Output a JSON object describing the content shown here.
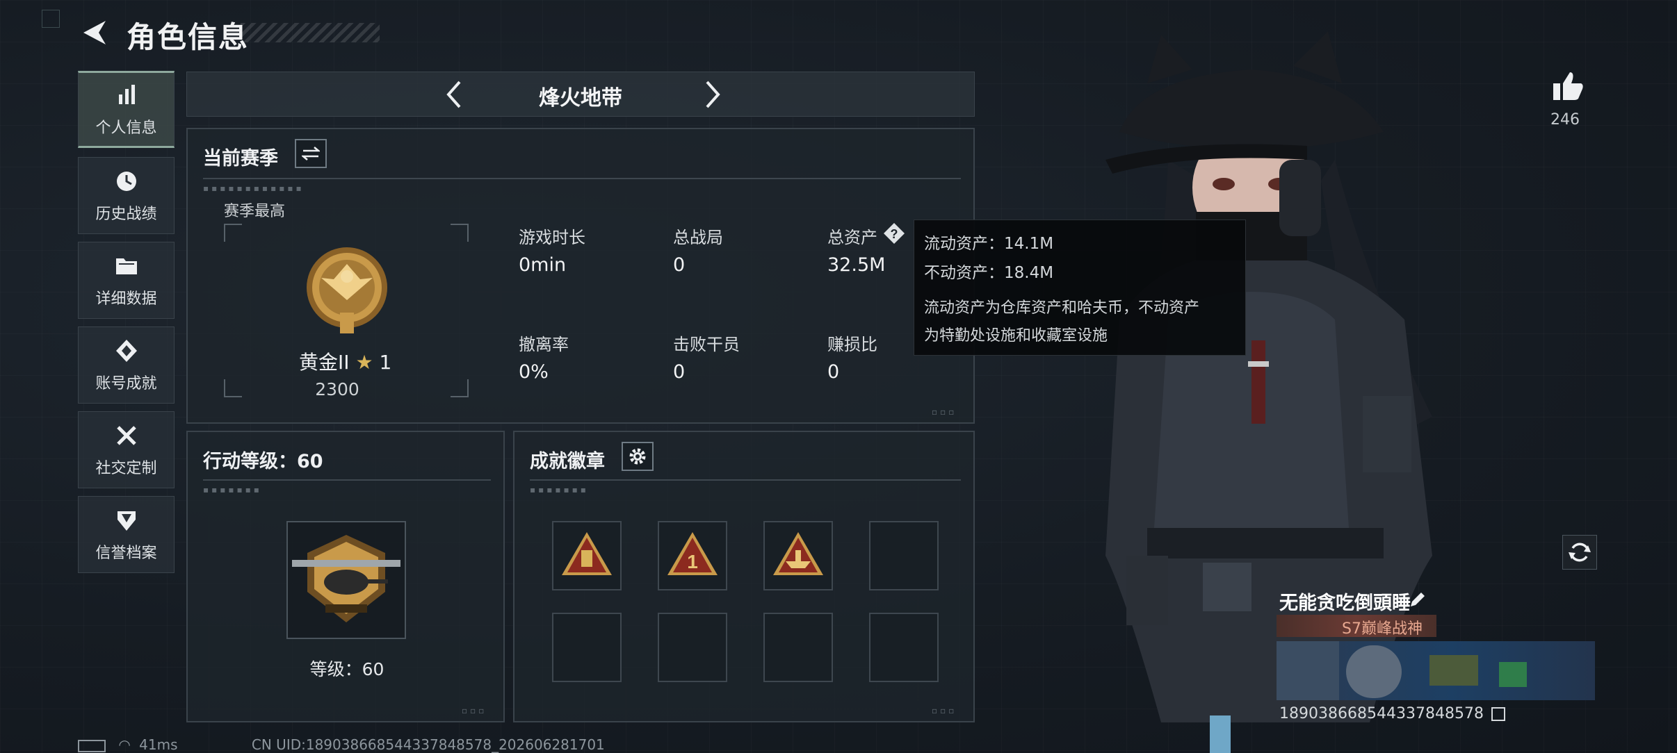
{
  "header": {
    "title": "角色信息"
  },
  "nav": [
    {
      "label": "个人信息",
      "icon": "bar-chart-icon",
      "active": true
    },
    {
      "label": "历史战绩",
      "icon": "history-icon"
    },
    {
      "label": "详细数据",
      "icon": "folder-icon"
    },
    {
      "label": "账号成就",
      "icon": "achievement-icon"
    },
    {
      "label": "社交定制",
      "icon": "tools-icon"
    },
    {
      "label": "信誉档案",
      "icon": "reputation-shield-icon"
    }
  ],
  "mode_tab": {
    "title": "烽火地带"
  },
  "season": {
    "title": "当前赛季",
    "highest_label": "赛季最高",
    "rank_name": "黄金II",
    "rank_stars": "1",
    "rank_points": "2300",
    "stats": [
      {
        "label": "游戏时长",
        "value": "0min"
      },
      {
        "label": "总战局",
        "value": "0"
      },
      {
        "label": "总资产",
        "value": "32.5M"
      },
      {
        "label": "撤离率",
        "value": "0%"
      },
      {
        "label": "击败干员",
        "value": "0"
      },
      {
        "label": "赚损比",
        "value": "0"
      }
    ]
  },
  "tooltip": {
    "liquid": "流动资产：14.1M",
    "fixed": "不动资产：18.4M",
    "desc_line1": "流动资产为仓库资产和哈夫币，不动资产",
    "desc_line2": "为特勤处设施和收藏室设施"
  },
  "action_level": {
    "title": "行动等级：60",
    "level_label": "等级：60"
  },
  "badges": {
    "title": "成就徽章",
    "slots": [
      "badge-1",
      "badge-2",
      "badge-3",
      "",
      "",
      "",
      "",
      ""
    ]
  },
  "profile": {
    "like_count": "246",
    "player_name": "无能贪吃倒頭睡",
    "player_title": "S7巅峰战神",
    "uid": "189038668544337848578"
  },
  "status_bar": {
    "ping": "41ms",
    "uid_line": "CN UID:189038668544337848578_202606281701"
  },
  "colors": {
    "accent_gold": "#c99a4a",
    "panel_border": "#3a434b",
    "badge_red": "#8c2a1f"
  }
}
